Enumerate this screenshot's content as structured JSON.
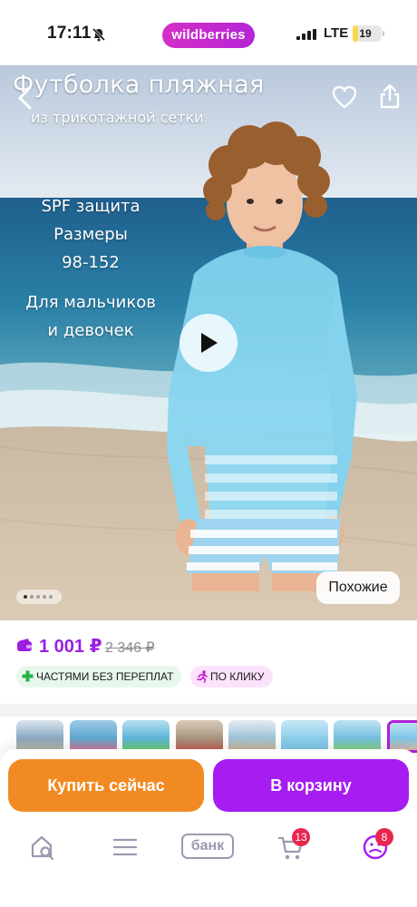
{
  "status_bar": {
    "time": "17:11",
    "brand": "wildberries",
    "network": "LTE",
    "battery": "19",
    "battery_level": 0.19
  },
  "hero": {
    "title": "Футболка пляжная",
    "subtitle": "из трикотажной сетки",
    "features": [
      "SPF защита",
      "Размеры",
      "98-152"
    ],
    "audience": [
      "Для мальчиков",
      "и девочек"
    ],
    "similar_label": "Похожие",
    "pager_count": 5,
    "pager_current": 1
  },
  "price": {
    "current": "1 001 ₽",
    "old": "2 346 ₽",
    "accent_color": "#9b1fe0"
  },
  "badges": {
    "installments": "ЧАСТЯМИ БЕЗ ПЕРЕПЛАТ",
    "one_click": "ПО КЛИКУ"
  },
  "actions": {
    "buy_now": "Купить сейчас",
    "add_to_cart": "В корзину",
    "buy_color": "#f28a23",
    "cart_color": "#a61cf1"
  },
  "bottom_nav": {
    "bank_label": "банк",
    "cart_count": "13",
    "profile_count": "8"
  },
  "icons": [
    "back-arrow-icon",
    "heart-icon",
    "share-icon",
    "play-icon",
    "wallet-icon",
    "plus-icon",
    "running-person-icon",
    "search-home-icon",
    "menu-icon",
    "cart-icon",
    "profile-icon"
  ]
}
